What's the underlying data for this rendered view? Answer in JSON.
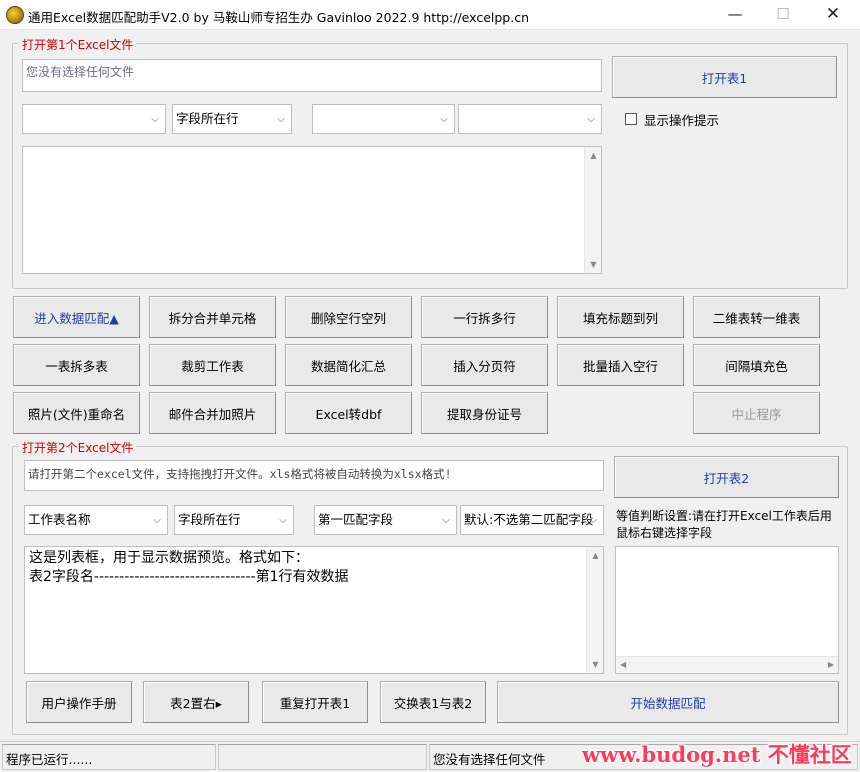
{
  "window": {
    "title": "通用Excel数据匹配助手V2.0 by 马鞍山师专招生办  Gavinloo  2022.9 http://excelpp.cn",
    "minimize_glyph": "—",
    "maximize_glyph": "☐",
    "close_glyph": "✕"
  },
  "file1": {
    "group_label": "打开第1个Excel文件",
    "path_text": "您没有选择任何文件",
    "open_button": "打开表1",
    "combo_1": "",
    "combo_2": "字段所在行",
    "combo_3": "",
    "combo_4": "",
    "show_tips_label": "显示操作提示",
    "show_tips_checked": false
  },
  "toolbar": {
    "rows": [
      [
        "进入数据匹配▲",
        "拆分合并单元格",
        "删除空行空列",
        "一行拆多行",
        "填充标题到列",
        "二维表转一维表"
      ],
      [
        "一表拆多表",
        "裁剪工作表",
        "数据简化汇总",
        "插入分页符",
        "批量插入空行",
        "间隔填充色"
      ],
      [
        "照片(文件)重命名",
        "邮件合并加照片",
        "Excel转dbf",
        "提取身份证号",
        "中止程序"
      ]
    ]
  },
  "file2": {
    "group_label": "打开第2个Excel文件",
    "hint_text": "请打开第二个excel文件，支持拖拽打开文件。xls格式将被自动转换为xlsx格式!",
    "open_button": "打开表2",
    "combo_sheet": "工作表名称",
    "combo_row": "字段所在行",
    "combo_field1": "第一匹配字段",
    "combo_field2": "默认:不选第二匹配字段",
    "equal_setting_text": "等值判断设置:请在打开Excel工作表后用鼠标右键选择字段",
    "preview_lines": [
      "这是列表框，用于显示数据预览。格式如下：",
      "表2字段名--------------------------------第1行有效数据"
    ]
  },
  "bottom_buttons": {
    "manual": "用户操作手册",
    "table2_right": "表2置右▸",
    "reopen_table1": "重复打开表1",
    "swap_tables": "交换表1与表2",
    "start_match": "开始数据匹配"
  },
  "status": {
    "left": "程序已运行......",
    "middle": "",
    "right": "您没有选择任何文件",
    "watermark": "www.budog.net 不懂社区"
  },
  "colors": {
    "legend_red": "#d00000",
    "button_blue": "#1f3ea8",
    "watermark_pink": "#ff3b5c"
  }
}
